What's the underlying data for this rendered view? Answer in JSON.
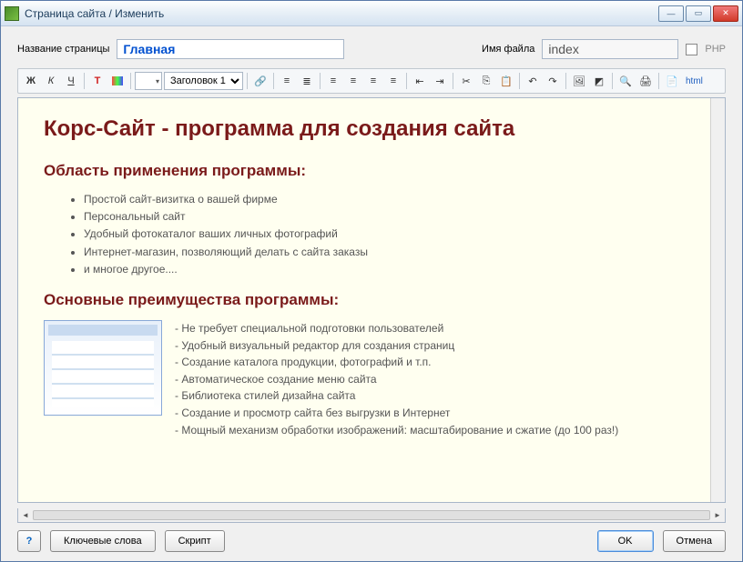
{
  "window": {
    "title": "Страница сайта / Изменить"
  },
  "form": {
    "page_name_label": "Название страницы",
    "page_name_value": "Главная",
    "file_name_label": "Имя файла",
    "file_name_value": "index",
    "php_label": "PHP"
  },
  "toolbar": {
    "bold": "Ж",
    "italic": "К",
    "underline": "Ч",
    "heading_select": "Заголовок 1",
    "html": "html"
  },
  "doc": {
    "h1": "Корс-Сайт - программа для создания сайта",
    "h2a": "Область применения программы:",
    "scope": [
      "Простой сайт-визитка о вашей фирме",
      "Персональный сайт",
      "Удобный фотокаталог ваших личных фотографий",
      "Интернет-магазин, позволяющий делать с сайта заказы",
      "и многое другое...."
    ],
    "h2b": "Основные преимущества программы:",
    "features": [
      "- Не требует специальной подготовки пользователей",
      "- Удобный визуальный редактор для создания страниц",
      "- Создание каталога продукции, фотографий и т.п.",
      "- Автоматическое создание меню сайта",
      "- Библиотека стилей дизайна сайта",
      "- Создание и просмотр сайта без выгрузки в Интернет",
      "- Мощный механизм обработки изображений: масштабирование и сжатие (до 100 раз!)"
    ]
  },
  "footer": {
    "help": "?",
    "keywords": "Ключевые слова",
    "script": "Скрипт",
    "ok": "OK",
    "cancel": "Отмена"
  }
}
